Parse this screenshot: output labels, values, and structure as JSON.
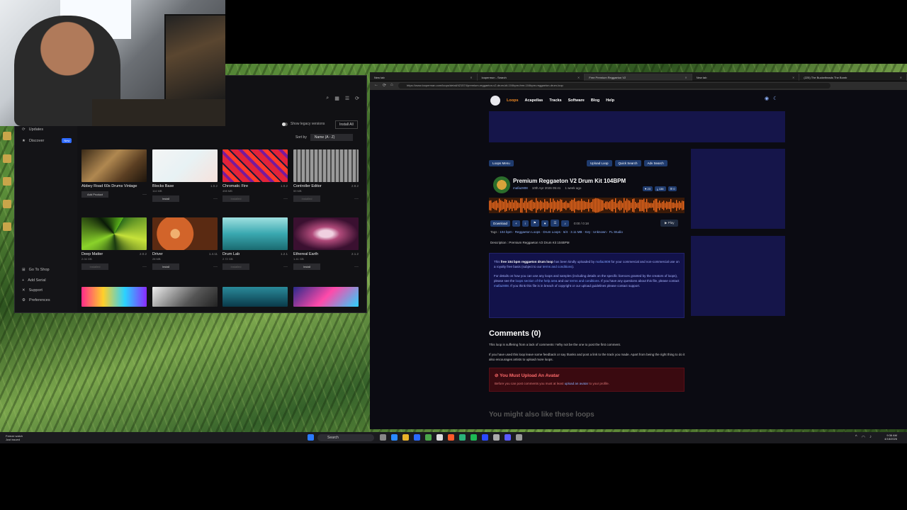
{
  "app": {
    "sidebar": {
      "top_items": [
        "Updates",
        "Discover"
      ],
      "new_badge": "New",
      "bottom_items": [
        "Go To Shop",
        "Add Serial",
        "Support",
        "Preferences"
      ]
    },
    "show_legacy": "Show legacy versions",
    "install_all": "Install All",
    "sort_by": "Sort by",
    "sort_value": "Name (A - Z)",
    "products": [
      {
        "name": "Abbey Road 60s Drums Vintage",
        "version": "",
        "size": "",
        "button": "Add Product"
      },
      {
        "name": "Blocks Base",
        "version": "1.0.2",
        "size": "114 MB",
        "button": "Install"
      },
      {
        "name": "Chromatic Fire",
        "version": "1.0.2",
        "size": "498 MB",
        "button": "Installed"
      },
      {
        "name": "Controller Editor",
        "version": "2.8.2",
        "size": "59 MB",
        "button": "Installed"
      },
      {
        "name": "Deep Matter",
        "version": "2.0.2",
        "size": "2.04 GB",
        "button": "Installed"
      },
      {
        "name": "Driver",
        "version": "1.4.11",
        "size": "28 MB",
        "button": "Install"
      },
      {
        "name": "Drum Lab",
        "version": "1.2.1",
        "size": "2.72 GB",
        "button": "Installed"
      },
      {
        "name": "Ethereal Earth",
        "version": "2.1.2",
        "size": "1.41 GB",
        "button": "Install"
      }
    ]
  },
  "browser": {
    "tabs": [
      "New tab",
      "loopermun - Search",
      "Free Premium Reggaeton V2",
      "New tab",
      "(225) The Bucketheads The Bomb"
    ],
    "url": "https://www.looperman.com/loops/detail/421574/premium-reggaeton-v2-drum-kit-104bpm-free-104bpm-reggaeton-drum-loop"
  },
  "site": {
    "nav": [
      "Loops",
      "Acapellas",
      "Tracks",
      "Software",
      "Blog",
      "Help"
    ],
    "loops_menu": "Loops Menu",
    "upload_loop": "Upload Loop",
    "quick_search": "Quick Search",
    "adv_search": "Adv Search",
    "loop_title": "Premium Reggaeton V2 Drum Kit 104BPM",
    "author": "mafiaz808",
    "date": "10th Apr 2026 05:41",
    "ago": "1 week ago",
    "stats": [
      "♥ 23",
      "⤓ 136",
      "☰ 0"
    ],
    "download": "Download",
    "time": "0:00 / 0:18",
    "play": "Play",
    "tags_label": "Tags :",
    "tags": "104 bpm · Reggaeton Loops · Drum Loops · 6/4 · 3.11 MB · Key : Unknown · FL Studio",
    "description_label": "Description : Premium Reggaeton V2 Drum Kit 104BPM",
    "desc_p1_a": "This",
    "desc_p1_bold": "free 104 bpm reggaeton drum loop",
    "desc_p1_b": "has been kindly uploaded by",
    "desc_p1_user": "mafiaz808",
    "desc_p1_c": "for your commercial and non-commercial use on a royalty free basis (subject to our",
    "desc_p1_terms": "terms and conditions",
    "desc_p2": "For details on how you can use any loops and samples (including details on the specific licences granted by the creators of loops), please see the",
    "desc_p2_link": "loops section of the help area",
    "desc_p2_b": "and our",
    "desc_p2_terms": "terms and conditions",
    "desc_p2_c": ". If you have any questions about this file, please contact",
    "desc_p2_user": "mafiaz808",
    "desc_p2_d": ". If you think this file is in breach of copyright or our upload guidelines please contact support.",
    "comments_title": "Comments (0)",
    "comments_empty": "This loop is suffering from a lack of comments ! Why not be the one to post the first comment.",
    "comments_hint": "If you have used this loop leave some feedback or say thanks and post a link to the track you made. Apart from being the right thing to do it also encourages artists to upload more loops.",
    "avatar_warn_title": "You Must Upload An Avatar",
    "avatar_warn_text_a": "Before you can post comments you must at least",
    "avatar_warn_link": "upload an avatar",
    "avatar_warn_text_b": "to your profile.",
    "also_like": "You might also like these loops"
  },
  "taskbar": {
    "weather_title": "Freeze watch",
    "weather_sub": "Just issued",
    "search": "Search",
    "time": "9:36 AM",
    "date": "4/18/2026"
  },
  "colors": {
    "accent": "#f08a24",
    "link": "#8fb3ff",
    "button": "#1f3b6e"
  }
}
